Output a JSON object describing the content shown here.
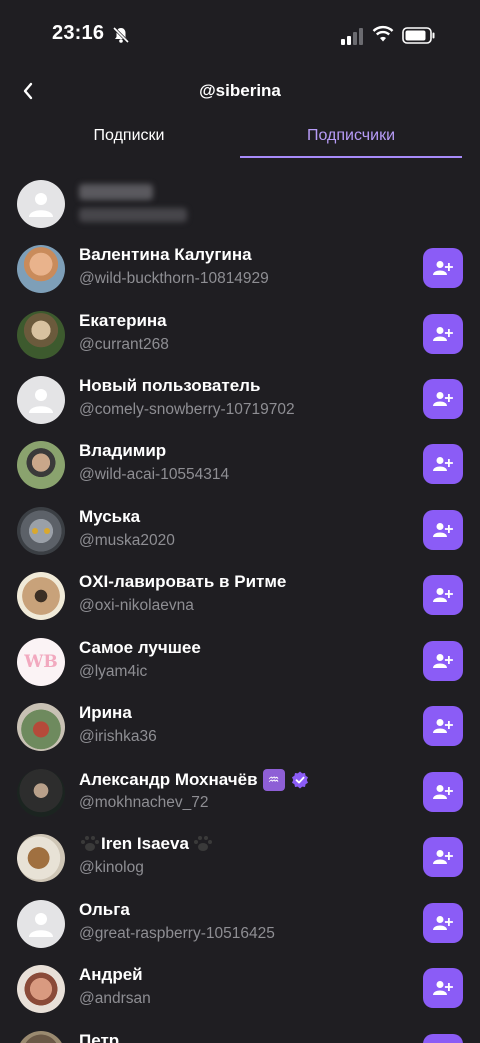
{
  "status_bar": {
    "time": "23:16"
  },
  "nav": {
    "title": "@siberina"
  },
  "tabs": [
    {
      "label": "Подписки",
      "active": false
    },
    {
      "label": "Подписчики",
      "active": true
    }
  ],
  "accent_color": "#8b5cf6",
  "users": [
    {
      "name": "Валентина Калугина",
      "handle": "@wild-buckthorn-10814929"
    },
    {
      "name": "Екатерина",
      "handle": "@currant268"
    },
    {
      "name": "Новый пользователь",
      "handle": "@comely-snowberry-10719702"
    },
    {
      "name": "Владимир",
      "handle": "@wild-acai-10554314"
    },
    {
      "name": "Муська",
      "handle": "@muska2020"
    },
    {
      "name": "OXI-лавировать в Ритме",
      "handle": "@oxi-nikolaevna"
    },
    {
      "name": "Самое лучшее",
      "handle": "@lyam4ic",
      "avatar_text": "WB"
    },
    {
      "name": "Ирина",
      "handle": "@irishka36"
    },
    {
      "name": "Александр Мохначёв",
      "handle": "@mokhnachev_72",
      "badges": [
        "aquarius-icon",
        "verified-icon"
      ]
    },
    {
      "name": "Iren Isaeva",
      "handle": "@kinolog",
      "decor": "paw-icon"
    },
    {
      "name": "Ольга",
      "handle": "@great-raspberry-10516425"
    },
    {
      "name": "Андрей",
      "handle": "@andrsan"
    },
    {
      "name": "Петр",
      "handle": ""
    }
  ]
}
